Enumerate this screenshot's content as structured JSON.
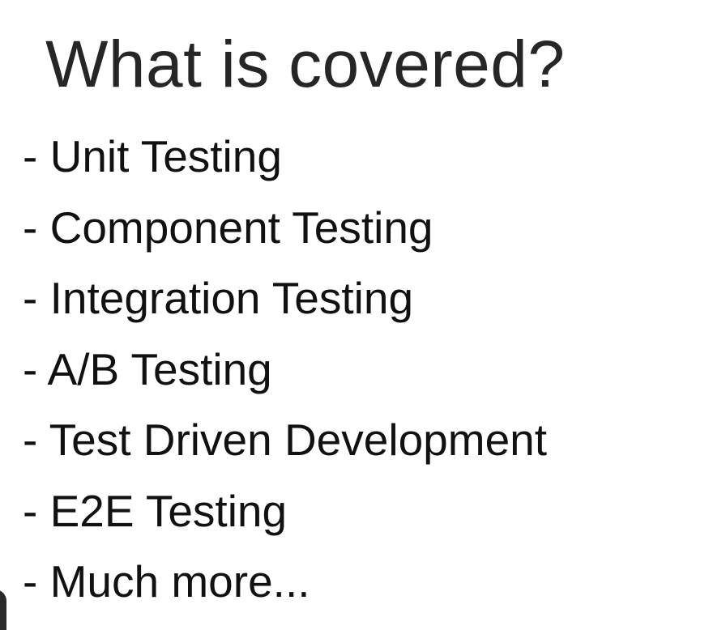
{
  "slide": {
    "title": "What is covered?",
    "items": [
      "- Unit Testing",
      "- Component Testing",
      "- Integration Testing",
      "- A/B Testing",
      "- Test Driven Development",
      "- E2E Testing",
      "- Much more..."
    ]
  },
  "colors": {
    "background": "#ffffff",
    "title_text": "#262626",
    "body_text": "#111111"
  }
}
